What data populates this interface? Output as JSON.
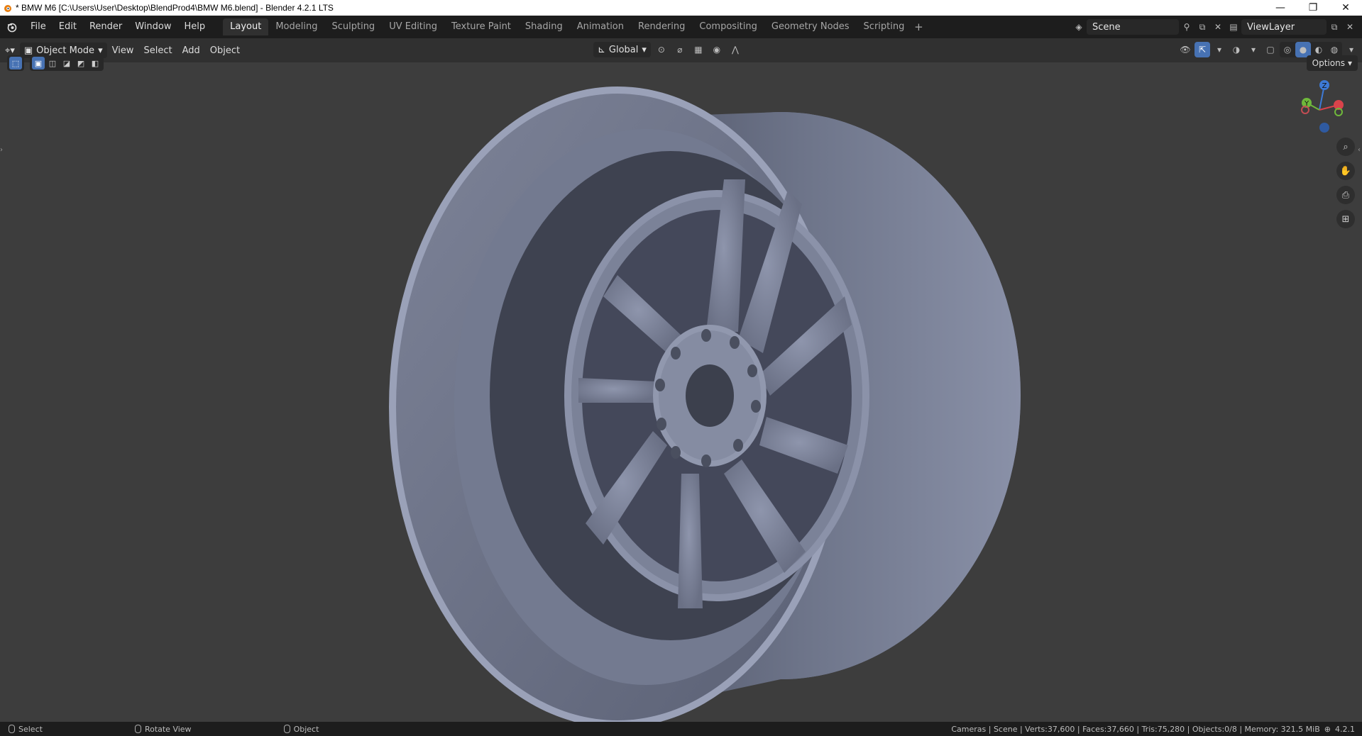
{
  "window": {
    "title": "* BMW M6 [C:\\Users\\User\\Desktop\\BlendProd4\\BMW M6.blend] - Blender 4.2.1 LTS",
    "minimize": "—",
    "restore": "❐",
    "close": "✕"
  },
  "menu": {
    "items": [
      "File",
      "Edit",
      "Render",
      "Window",
      "Help"
    ]
  },
  "workspaces": {
    "tabs": [
      "Layout",
      "Modeling",
      "Sculpting",
      "UV Editing",
      "Texture Paint",
      "Shading",
      "Animation",
      "Rendering",
      "Compositing",
      "Geometry Nodes",
      "Scripting"
    ],
    "active": "Layout",
    "add": "+"
  },
  "scene": {
    "name": "Scene"
  },
  "viewlayer": {
    "name": "ViewLayer"
  },
  "header": {
    "mode": "Object Mode",
    "menus": [
      "View",
      "Select",
      "Add",
      "Object"
    ],
    "transform_orientation": "Global"
  },
  "viewport": {
    "options_label": "Options",
    "gizmo": {
      "z": "Z",
      "y": "Y",
      "x": "X"
    },
    "colors": {
      "background": "#3d3d3d",
      "rim": "#8a92ad",
      "rim_dark": "#5b6176",
      "accent": "#4772b3"
    }
  },
  "status": {
    "hints": [
      "Select",
      "Rotate View",
      "Object"
    ],
    "info": "Cameras | Scene | Verts:37,600 | Faces:37,660 | Tris:75,280 | Objects:0/8 | Memory: 321.5 MiB",
    "version": "4.2.1"
  }
}
